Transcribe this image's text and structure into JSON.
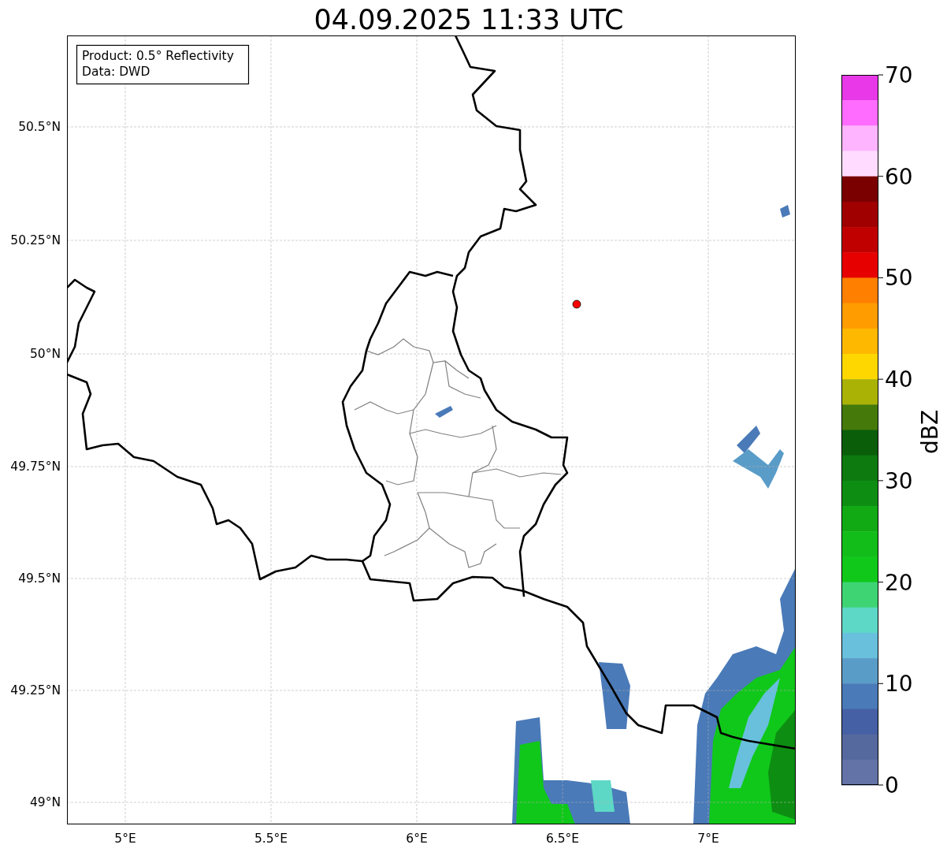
{
  "title": "04.09.2025 11:33 UTC",
  "legend": [
    "Product: 0.5° Reflectivity",
    "Data: DWD"
  ],
  "x_ticks": [
    "5°E",
    "5.5°E",
    "6°E",
    "6.5°E",
    "7°E"
  ],
  "y_ticks": [
    "50.5°N",
    "50.25°N",
    "50°N",
    "49.75°N",
    "49.5°N",
    "49.25°N",
    "49°N"
  ],
  "colorbar": {
    "label": "dBZ",
    "ticks": [
      "70",
      "60",
      "50",
      "40",
      "30",
      "20",
      "10",
      "0"
    ],
    "segments": [
      {
        "color": "#e838e8"
      },
      {
        "color": "#ff6cff"
      },
      {
        "color": "#ffb4ff"
      },
      {
        "color": "#ffdcff"
      },
      {
        "color": "#7a0000"
      },
      {
        "color": "#a00000"
      },
      {
        "color": "#c00000"
      },
      {
        "color": "#e60000"
      },
      {
        "color": "#ff7f00"
      },
      {
        "color": "#ff9c00"
      },
      {
        "color": "#ffb800"
      },
      {
        "color": "#ffd700"
      },
      {
        "color": "#aab206"
      },
      {
        "color": "#457a0a"
      },
      {
        "color": "#0a5e0a"
      },
      {
        "color": "#0d7a10"
      },
      {
        "color": "#0d8e12"
      },
      {
        "color": "#11aa15"
      },
      {
        "color": "#12bd19"
      },
      {
        "color": "#10c81a"
      },
      {
        "color": "#3ed474"
      },
      {
        "color": "#5ed8c6"
      },
      {
        "color": "#68c0dc"
      },
      {
        "color": "#5a9cc8"
      },
      {
        "color": "#4a7ab8"
      },
      {
        "color": "#4660a5"
      },
      {
        "color": "#55699e"
      },
      {
        "color": "#6373a8"
      }
    ]
  }
}
